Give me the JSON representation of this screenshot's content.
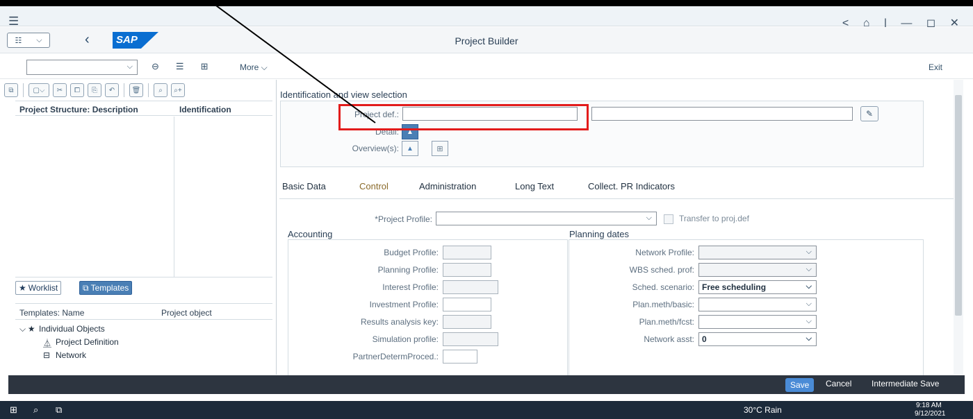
{
  "window": {
    "controls": "<  ⌂  |  —  ◻  ✕"
  },
  "shell": {
    "title": "Project Builder",
    "logo": "SAP"
  },
  "toolbar": {
    "more": "More",
    "exit": "Exit"
  },
  "left": {
    "tree_headers": [
      "Project Structure: Description",
      "Identification"
    ],
    "tabs": [
      "Worklist",
      "Templates"
    ],
    "tmpl_headers": [
      "Templates: Name",
      "Project object"
    ],
    "tmpl_rows": [
      "Individual Objects",
      "Project Definition",
      "Network"
    ]
  },
  "right": {
    "section_title": "Identification and view selection",
    "project_def_label": "Project def.:",
    "detail_label": "Detail:",
    "overview_label": "Overview(s):",
    "tabs": [
      "Basic Data",
      "Control",
      "Administration",
      "Long Text",
      "Collect. PR Indicators"
    ],
    "project_profile_label": "*Project Profile:",
    "transfer_label": "Transfer to proj.def",
    "accounting_title": "Accounting",
    "accounting_fields": [
      "Budget Profile:",
      "Planning Profile:",
      "Interest Profile:",
      "Investment Profile:",
      "Results analysis key:",
      "Simulation profile:",
      "PartnerDetermProced.:"
    ],
    "planning_title": "Planning dates",
    "planning_fields": [
      {
        "label": "Network Profile:",
        "value": ""
      },
      {
        "label": "WBS sched. prof:",
        "value": ""
      },
      {
        "label": "Sched. scenario:",
        "value": "Free scheduling"
      },
      {
        "label": "Plan.meth/basic:",
        "value": ""
      },
      {
        "label": "Plan.meth/fcst:",
        "value": ""
      },
      {
        "label": "Network asst:",
        "value": "0"
      }
    ]
  },
  "status": {
    "save": "Save",
    "cancel": "Cancel",
    "intermediate": "Intermediate Save"
  },
  "taskbar": {
    "weather": "30°C Rain",
    "time": "9:18 AM",
    "date": "9/12/2021"
  },
  "colors": {
    "accent": "#0a6ed1",
    "highlight": "#e21b1b"
  }
}
